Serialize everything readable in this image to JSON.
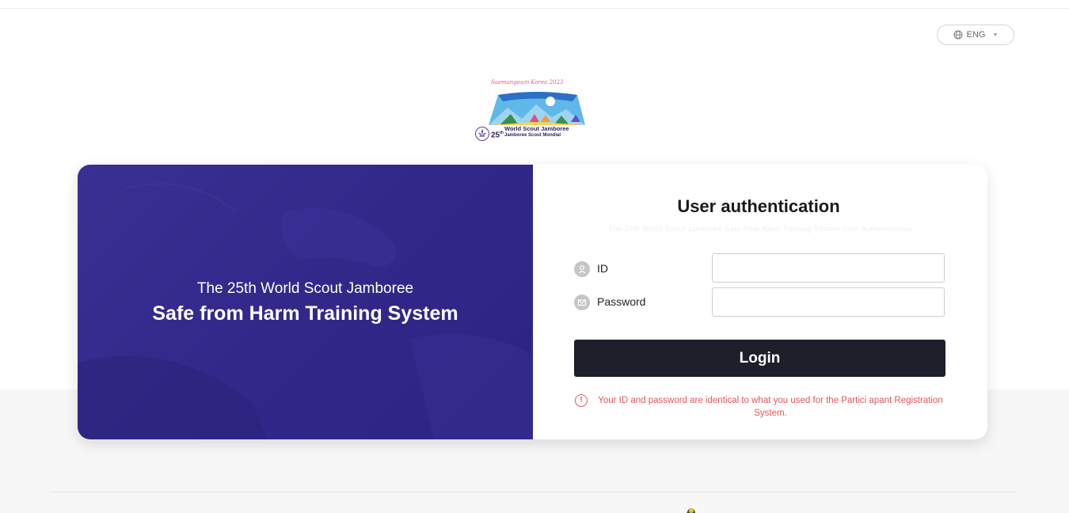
{
  "language": {
    "label": "ENG",
    "icon": "globe-icon"
  },
  "logo": {
    "banner": "Saemangeum Korea 2023",
    "number": "25",
    "number_suffix": "th",
    "line1": "World Scout Jamboree",
    "line2": "Jamboree Scout Mondial"
  },
  "hero": {
    "subtitle": "The 25th World Scout Jamboree",
    "title": "Safe from Harm Training System"
  },
  "auth": {
    "title": "User authentication",
    "faint_text": "The 25th World Scout Jamboree Safe from Harm Training System User Authentication",
    "id_label": "ID",
    "id_value": "",
    "password_label": "Password",
    "password_value": "",
    "login_label": "Login",
    "notice_icon": "!",
    "notice": "Your ID and password are identical to what you used for the Partici apant Registration System."
  },
  "colors": {
    "hero_bg": "#32288a",
    "login_bg": "#1d1f2b",
    "notice": "#e0565c"
  }
}
